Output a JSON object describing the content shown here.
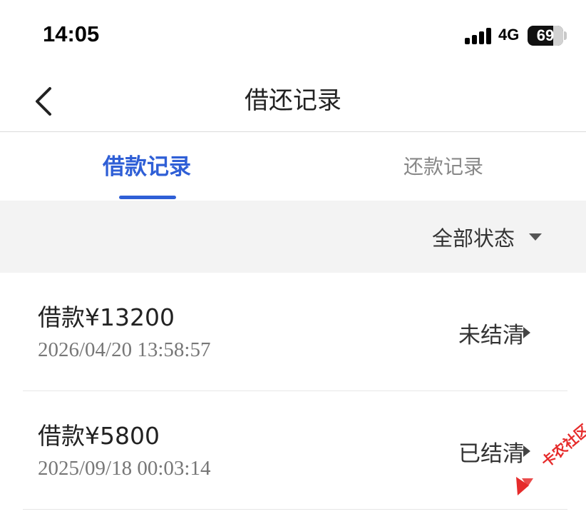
{
  "status_bar": {
    "time": "14:05",
    "network": "4G",
    "battery": "69"
  },
  "nav": {
    "title": "借还记录"
  },
  "tabs": [
    {
      "label": "借款记录",
      "active": true
    },
    {
      "label": "还款记录",
      "active": false
    }
  ],
  "filter": {
    "label": "全部状态"
  },
  "records": [
    {
      "amount": "借款¥13200",
      "date": "2026/04/20 13:58:57",
      "status": "未结清"
    },
    {
      "amount": "借款¥5800",
      "date": "2025/09/18 00:03:14",
      "status": "已结清"
    }
  ],
  "watermark": {
    "text": "卡农社区"
  },
  "colors": {
    "accent": "#2f5fd6",
    "watermark": "#e62b2b"
  }
}
